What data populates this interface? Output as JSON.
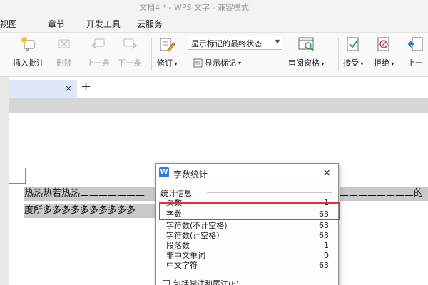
{
  "window": {
    "title": "文档4 * - WPS 文字 - 兼容模式"
  },
  "menu": {
    "tabs": [
      "视图",
      "章节",
      "开发工具",
      "云服务"
    ]
  },
  "ribbon": {
    "insert_comment": "插入批注",
    "delete": "删除",
    "prev": "上一条",
    "next": "下一条",
    "track_changes": "修订",
    "markup_mode": "显示标记的最终状态",
    "show_markup": "显示标记",
    "review_pane": "审阅窗格",
    "accept": "接受",
    "reject": "拒绝",
    "prev_change": "上一"
  },
  "tabbar": {
    "close": "×",
    "new_tab": "+"
  },
  "document": {
    "line1_start": "热热热若热热二二二二二二二",
    "line1_end": "二二二二二二二二的",
    "line2": "度所多多多多多多多多多多"
  },
  "dialog": {
    "title": "字数统计",
    "close": "×",
    "group": "统计信息",
    "rows": [
      {
        "label": "页数",
        "value": "1"
      },
      {
        "label": "字数",
        "value": "63"
      },
      {
        "label": "字符数(不计空格)",
        "value": "63"
      },
      {
        "label": "字符数(计空格)",
        "value": "63"
      },
      {
        "label": "段落数",
        "value": "1"
      },
      {
        "label": "非中文单词",
        "value": "0"
      },
      {
        "label": "中文字符",
        "value": "63"
      }
    ],
    "include_footnotes": "包括脚注和尾注(F)"
  },
  "colors": {
    "highlight_border": "#d9363e",
    "selection": "#c9c9c9",
    "app_icon": "#2f7ae0"
  }
}
